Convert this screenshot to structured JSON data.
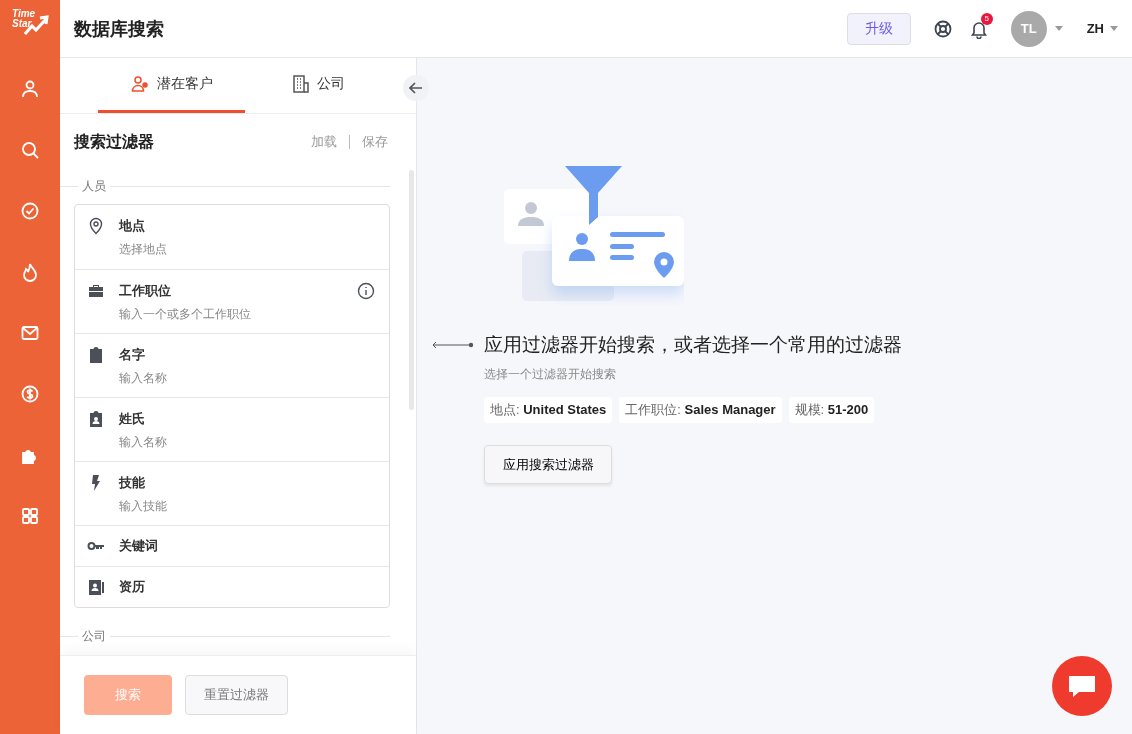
{
  "logo": {
    "line1": "Time",
    "line2": "Star"
  },
  "header": {
    "title": "数据库搜索",
    "upgrade_button": "升级",
    "notification_count": "5",
    "avatar_initials": "TL",
    "language": "ZH"
  },
  "tabs": [
    {
      "label": "潜在客户",
      "selected": true
    },
    {
      "label": "公司",
      "selected": false
    }
  ],
  "filter_panel": {
    "title": "搜索过滤器",
    "load": "加载",
    "save": "保存",
    "section_people": "人员",
    "filters": [
      {
        "label": "地点",
        "placeholder": "选择地点",
        "info": false
      },
      {
        "label": "工作职位",
        "placeholder": "输入一个或多个工作职位",
        "info": true
      },
      {
        "label": "名字",
        "placeholder": "输入名称",
        "info": false
      },
      {
        "label": "姓氏",
        "placeholder": "输入名称",
        "info": false
      },
      {
        "label": "技能",
        "placeholder": "输入技能",
        "info": false
      },
      {
        "label": "关键词",
        "info": false
      },
      {
        "label": "资历",
        "info": false
      }
    ],
    "section_company": "公司",
    "search_button": {
      "label": "搜索",
      "disabled": true
    },
    "reset_button": "重置过滤器"
  },
  "empty_state": {
    "heading": "应用过滤器开始搜索，或者选择一个常用的过滤器",
    "subheading": "选择一个过滤器开始搜索",
    "chips": [
      "地点: **United States**",
      "工作职位: **Sales Manager**",
      "规模: **51-200**"
    ],
    "apply_button": "应用搜索过滤器"
  }
}
